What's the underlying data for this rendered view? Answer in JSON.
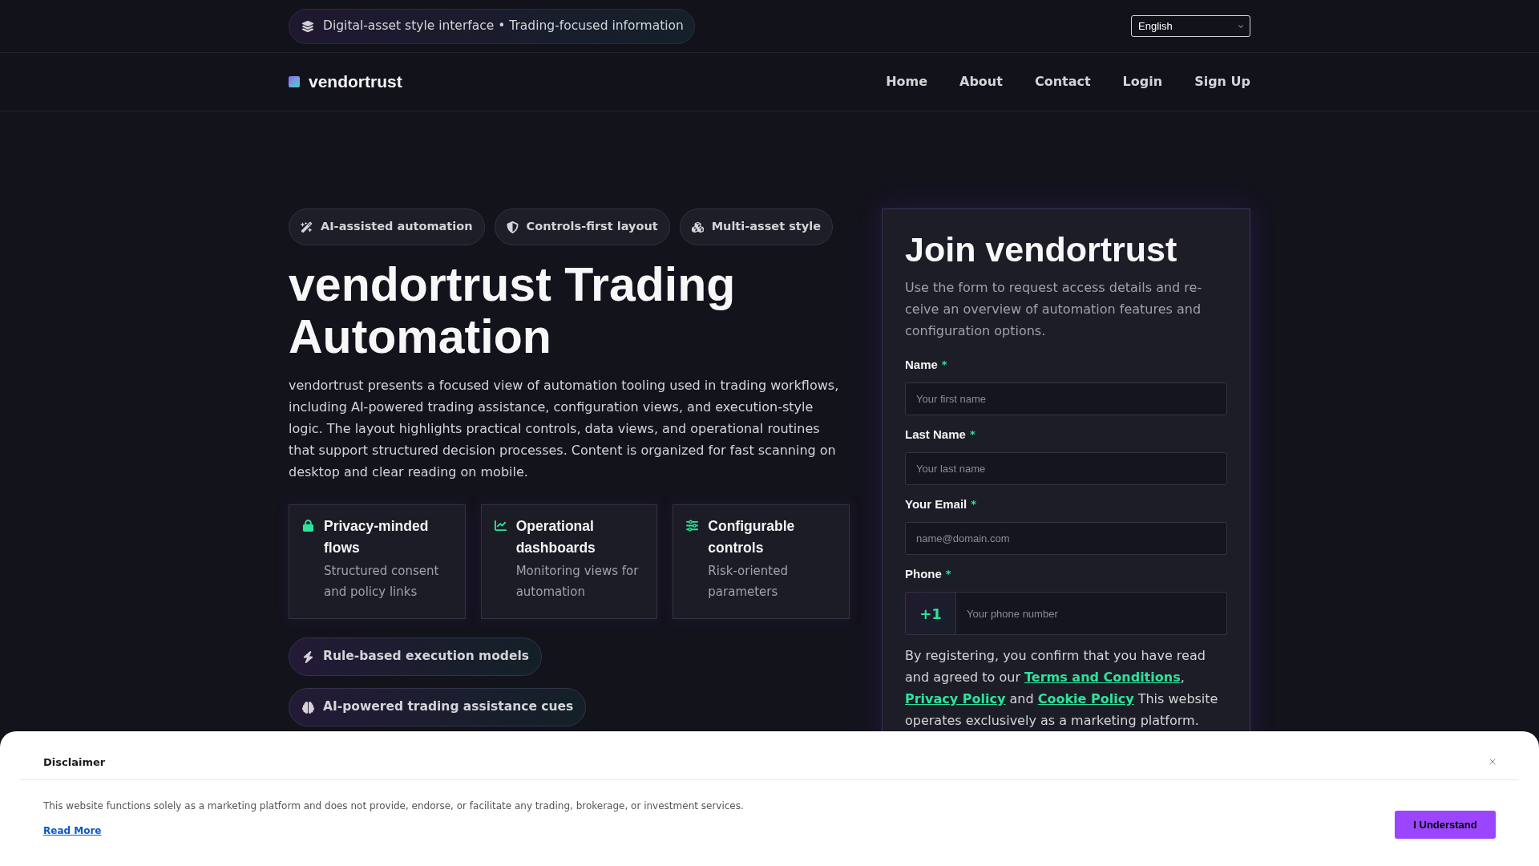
{
  "top_bar": {
    "tagline": "Digital-asset style interface • Trading-focused information",
    "language": "English"
  },
  "nav": {
    "brand": "vendortrust",
    "links": [
      "Home",
      "About",
      "Contact",
      "Login",
      "Sign Up"
    ]
  },
  "hero": {
    "badges": [
      "AI-assisted automation",
      "Controls-first layout",
      "Multi-asset style"
    ],
    "title": "vendortrust Trading Automation",
    "description": "vendortrust presents a focused view of automation tooling used in trading workflows, including AI-powered trading assistance, configuration views, and execution-style logic. The layout highlights practical controls, data views, and operational routines that support structured decision processes. Content is organized for fast scanning on desktop and clear reading on mobile.",
    "features": [
      {
        "title": "Privacy-minded flows",
        "description": "Structured consent and policy links"
      },
      {
        "title": "Operational dashboards",
        "description": "Monitoring views for automation"
      },
      {
        "title": "Configurable controls",
        "description": "Risk-oriented parameters"
      }
    ],
    "highlights": [
      "Rule-based execution models",
      "AI-powered trading assistance cues"
    ]
  },
  "signup_form": {
    "title": "Join vendortrust",
    "description": "Use the form to request access details and re-ceive an overview of automation features and configuration options.",
    "fields": [
      {
        "kind": "input",
        "label": "Name",
        "required_mark": "*",
        "placeholder": "Your first name"
      },
      {
        "kind": "input",
        "label": "Last Name",
        "required_mark": "*",
        "placeholder": "Your last name"
      },
      {
        "kind": "input",
        "label": "Your Email",
        "required_mark": "*",
        "placeholder": "name@domain.com"
      },
      {
        "kind": "phone",
        "label": "Phone",
        "required_mark": "*",
        "prefix": "+1",
        "placeholder": "Your phone number"
      }
    ],
    "consent": [
      {
        "kind": "text",
        "text": "By registering, you confirm that you have read and agreed to our "
      },
      {
        "kind": "link",
        "text": "Terms and Conditions"
      },
      {
        "kind": "text",
        "text": ", "
      },
      {
        "kind": "link",
        "text": "Privacy Policy"
      },
      {
        "kind": "text",
        "text": " and "
      },
      {
        "kind": "link",
        "text": "Cookie Policy"
      },
      {
        "kind": "text",
        "text": " This website operates exclusively as a marketing platform."
      }
    ]
  },
  "disclaimer": {
    "title": "Disclaimer",
    "text": "This website functions solely as a marketing platform and does not provide, endorse, or facilitate any trading, brokerage, or investment services.",
    "link": "Read More",
    "button": "I Understand"
  }
}
